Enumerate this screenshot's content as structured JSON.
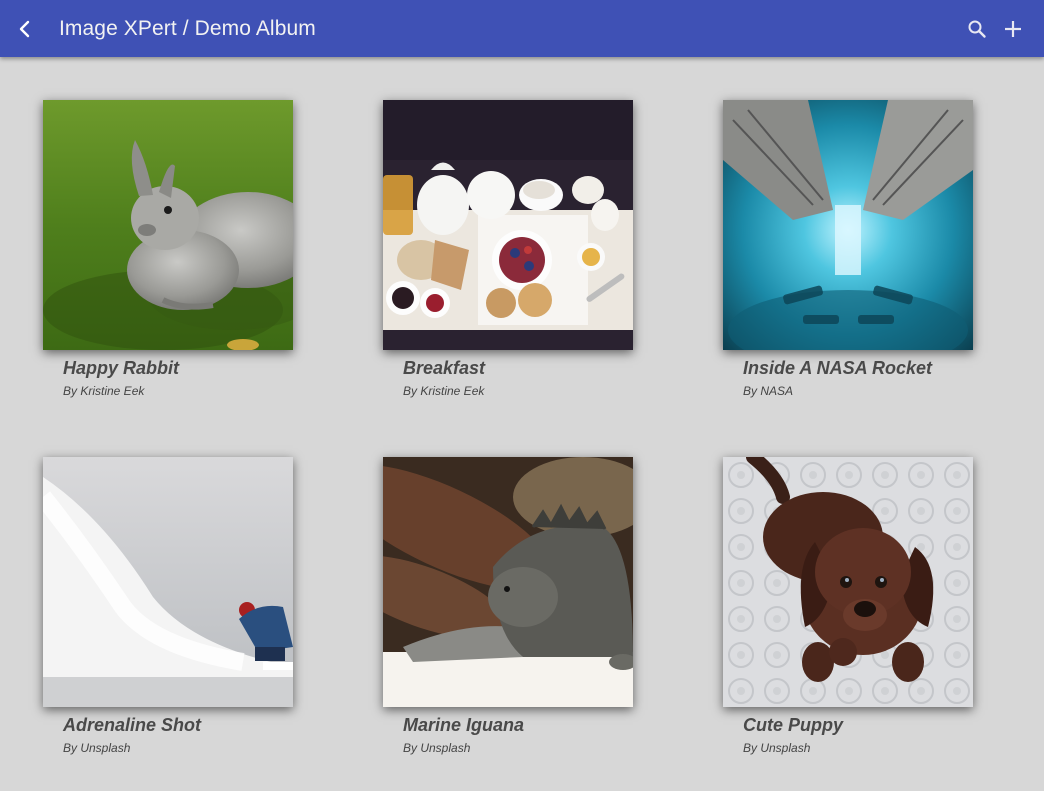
{
  "appbar": {
    "title": "Image XPert / Demo Album",
    "back_icon": "chevron-left-icon",
    "search_icon": "search-icon",
    "add_icon": "plus-icon",
    "color": "#3f51b5"
  },
  "album": {
    "photos": [
      {
        "title": "Happy Rabbit",
        "author": "By Kristine Eek"
      },
      {
        "title": "Breakfast",
        "author": "By Kristine Eek"
      },
      {
        "title": "Inside A NASA Rocket",
        "author": "By NASA"
      },
      {
        "title": "Adrenaline Shot",
        "author": "By Unsplash"
      },
      {
        "title": "Marine Iguana",
        "author": "By Unsplash"
      },
      {
        "title": "Cute Puppy",
        "author": "By Unsplash"
      }
    ]
  }
}
